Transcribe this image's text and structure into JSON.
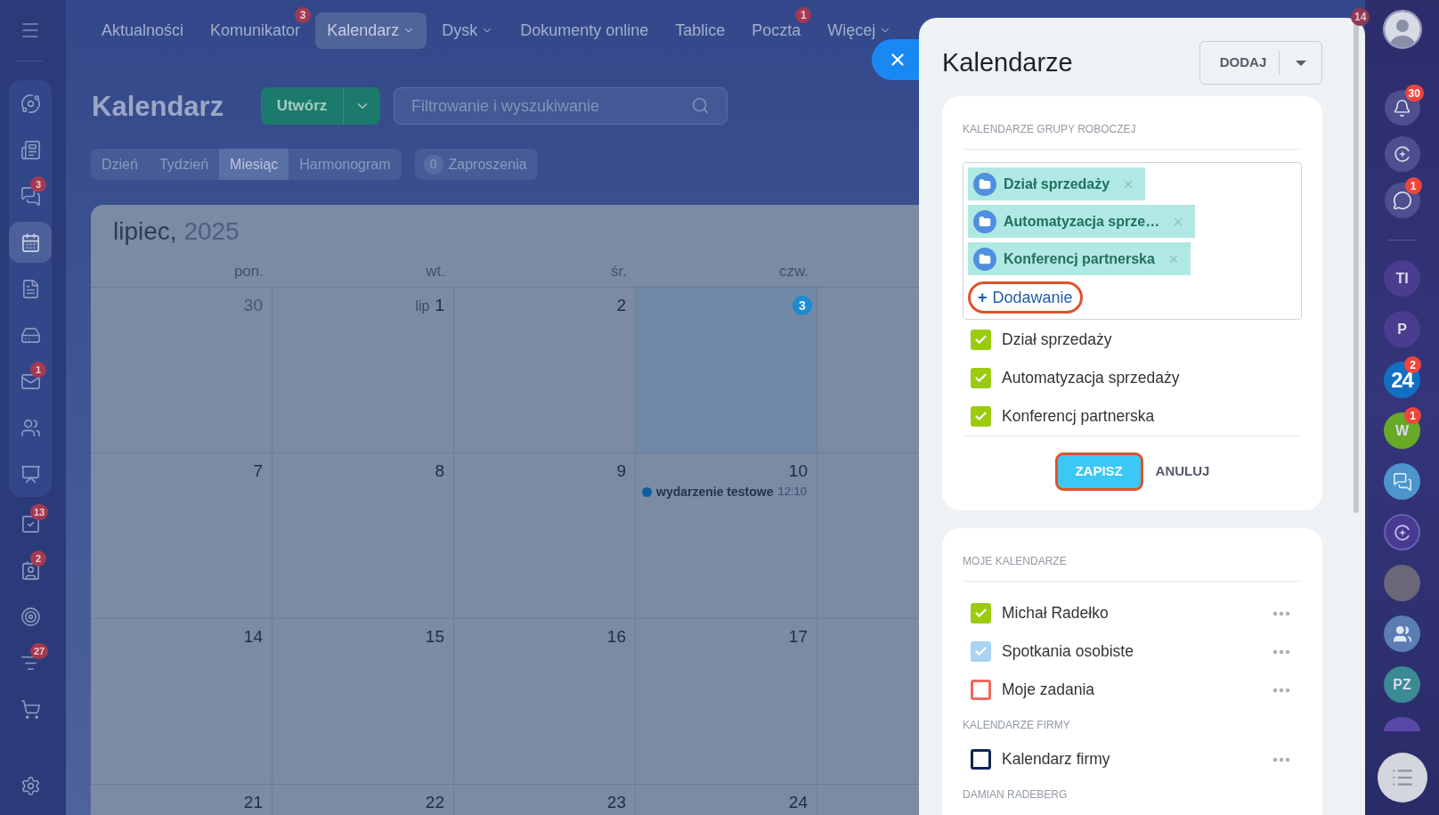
{
  "top_nav": {
    "items": [
      {
        "label": "Aktualności",
        "selected": false,
        "dropdown": false
      },
      {
        "label": "Komunikator",
        "selected": false,
        "dropdown": false,
        "badge": "3"
      },
      {
        "label": "Kalendarz",
        "selected": true,
        "dropdown": true
      },
      {
        "label": "Dysk",
        "selected": false,
        "dropdown": true
      },
      {
        "label": "Dokumenty online",
        "selected": false,
        "dropdown": false
      },
      {
        "label": "Tablice",
        "selected": false,
        "dropdown": false
      },
      {
        "label": "Poczta",
        "selected": false,
        "dropdown": false,
        "badge": "1"
      },
      {
        "label": "Więcej",
        "selected": false,
        "dropdown": true
      }
    ],
    "corner_badge": "14"
  },
  "sidebar": {
    "group_items": [
      {
        "selected": false
      },
      {
        "selected": false
      },
      {
        "selected": false,
        "badge": "3"
      },
      {
        "selected": true
      },
      {
        "selected": false
      },
      {
        "selected": false
      },
      {
        "selected": false,
        "badge": "1"
      },
      {
        "selected": false
      },
      {
        "selected": false
      }
    ],
    "items": [
      {
        "selected": false,
        "badge": "13"
      },
      {
        "selected": false,
        "badge": "2"
      },
      {
        "selected": false
      },
      {
        "selected": false,
        "badge": "27"
      },
      {
        "selected": false
      }
    ]
  },
  "calendar": {
    "title": "Kalendarz",
    "create_button": "Utwórz",
    "search": {
      "placeholder": "Filtrowanie i wyszukiwanie"
    },
    "views": [
      {
        "label": "Dzień",
        "selected": false
      },
      {
        "label": "Tydzień",
        "selected": false
      },
      {
        "label": "Miesiąc",
        "selected": true
      },
      {
        "label": "Harmonogram",
        "selected": false
      }
    ],
    "invitations": {
      "count": "0",
      "label": "Zaproszenia"
    },
    "month": "lipiec,",
    "year": "2025",
    "weekdays": [
      "pon.",
      "wt.",
      "śr.",
      "czw."
    ],
    "weeks": [
      [
        {
          "day": "30",
          "muted": true,
          "today": false
        },
        {
          "month_prefix": "lip",
          "day": "1",
          "muted": false,
          "today": false
        },
        {
          "day": "2",
          "muted": false,
          "today": false
        },
        {
          "day": "3",
          "muted": false,
          "today": true
        }
      ],
      [
        {
          "day": "7",
          "muted": false,
          "today": false
        },
        {
          "day": "8",
          "muted": false,
          "today": false
        },
        {
          "day": "9",
          "muted": false,
          "today": false
        },
        {
          "day": "10",
          "muted": false,
          "today": false,
          "events": [
            {
              "title": "wydarzenie testowe",
              "time": "12:10",
              "color": "#0c5d9e"
            }
          ]
        }
      ],
      [
        {
          "day": "14",
          "muted": false,
          "today": false
        },
        {
          "day": "15",
          "muted": false,
          "today": false
        },
        {
          "day": "16",
          "muted": false,
          "today": false
        },
        {
          "day": "17",
          "muted": false,
          "today": false
        }
      ],
      [
        {
          "day": "21",
          "muted": false,
          "today": false
        },
        {
          "day": "22",
          "muted": false,
          "today": false
        },
        {
          "day": "23",
          "muted": false,
          "today": false
        },
        {
          "day": "24",
          "muted": false,
          "today": false
        }
      ]
    ]
  },
  "panel": {
    "title": "Kalendarze",
    "add_button": "DODAJ",
    "workgroup": {
      "heading": "KALENDARZE GRUPY ROBOCZEJ",
      "tags": [
        {
          "label": "Dział sprzedaży"
        },
        {
          "label": "Automatyzacja sprze…"
        },
        {
          "label": "Konferencj partnerska"
        }
      ],
      "add_link": {
        "plus": "+",
        "label": "Dodawanie",
        "highlighted": true
      },
      "items": [
        {
          "label": "Dział sprzedaży",
          "checked": true,
          "color": "#9bcb0f"
        },
        {
          "label": "Automatyzacja sprzedaży",
          "checked": true,
          "color": "#9bcb0f"
        },
        {
          "label": "Konferencj partnerska",
          "checked": true,
          "color": "#9bcb0f"
        }
      ],
      "save_button": {
        "label": "ZAPISZ",
        "highlighted": true
      },
      "cancel_button": "ANULUJ"
    },
    "my_calendars": {
      "heading": "MOJE KALENDARZE",
      "items": [
        {
          "label": "Michał Radełko",
          "checked": true,
          "color": "#9bcb0f"
        },
        {
          "label": "Spotkania osobiste",
          "checked": true,
          "color": "#a9d2f3"
        },
        {
          "label": "Moje zadania",
          "checked": false,
          "color": "#ee6a5e"
        }
      ],
      "groups": [
        {
          "heading": "KALENDARZE FIRMY",
          "items": [
            {
              "label": "Kalendarz firmy",
              "checked": false,
              "color": "#0f2554"
            }
          ]
        },
        {
          "heading": "DAMIAN RADEBERG"
        }
      ]
    }
  },
  "right_bar": {
    "top": [
      {
        "kind": "avatar"
      },
      {
        "kind": "bell",
        "badge": "30"
      },
      {
        "kind": "assistant"
      },
      {
        "kind": "chat_switch",
        "badge": "1"
      }
    ],
    "apps": [
      {
        "kind": "initials",
        "label": "TI",
        "color": "#4a3d8f"
      },
      {
        "kind": "initials",
        "label": "P",
        "color": "#4a3d8f"
      },
      {
        "kind": "logo",
        "label": "24",
        "color": "#1170c3",
        "badge": "2"
      },
      {
        "kind": "initials",
        "label": "W",
        "color": "#68a925",
        "badge": "1"
      },
      {
        "kind": "chat"
      },
      {
        "kind": "assistant"
      },
      {
        "kind": "photo"
      },
      {
        "kind": "people"
      },
      {
        "kind": "initials",
        "label": "PZ",
        "color": "#3b8a94"
      },
      {
        "kind": "blank",
        "color": "#5a48a8"
      }
    ]
  }
}
